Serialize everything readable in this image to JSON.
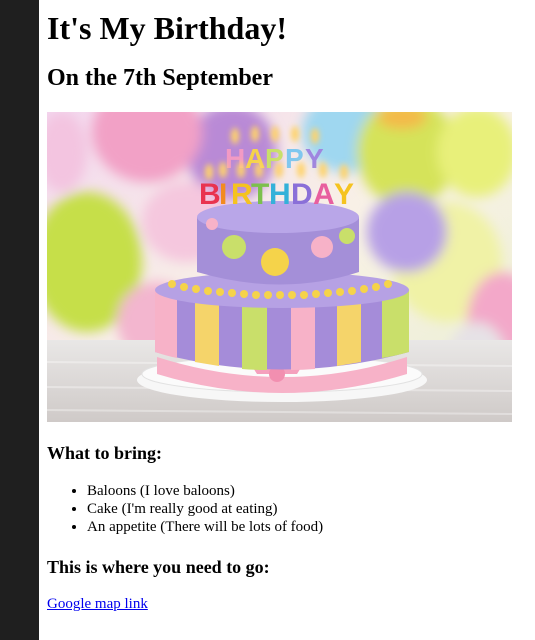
{
  "page": {
    "title": "It's My Birthday!",
    "subtitle": "On the 7th September",
    "cake_image": {
      "name": "birthday-cake-image",
      "candle_text": "HAPPY BIRTHDAY"
    },
    "bring": {
      "heading": "What to bring:",
      "items": [
        "Baloons (I love baloons)",
        "Cake (I'm really good at eating)",
        "An appetite (There will be lots of food)"
      ]
    },
    "location": {
      "heading": "This is where you need to go:",
      "link_text": "Google map link"
    }
  },
  "colors": {
    "sidebar": "#1f1f1f",
    "link": "#0000ee",
    "text": "#000000"
  }
}
